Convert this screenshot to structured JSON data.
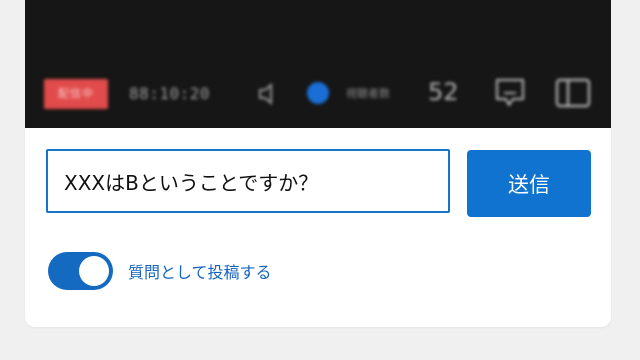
{
  "player": {
    "live_badge": "配信中",
    "elapsed_time": "88:10:20",
    "viewer_label": "視聴者数",
    "viewer_count": "52",
    "icons": {
      "volume": "volume-icon",
      "viewer": "viewer-status-dot",
      "comment": "comment-icon",
      "layout": "sidebar-layout-icon"
    },
    "colors": {
      "live_badge": "#e14b4b",
      "viewer_dot": "#1a6fd6"
    }
  },
  "question_form": {
    "input_value": "XXXはBということですか？",
    "send_label": "送信",
    "post_as_question_label": "質問として投稿する",
    "post_as_question_on": true,
    "colors": {
      "accent": "#0f73cf",
      "input_border": "#1774c8"
    }
  }
}
